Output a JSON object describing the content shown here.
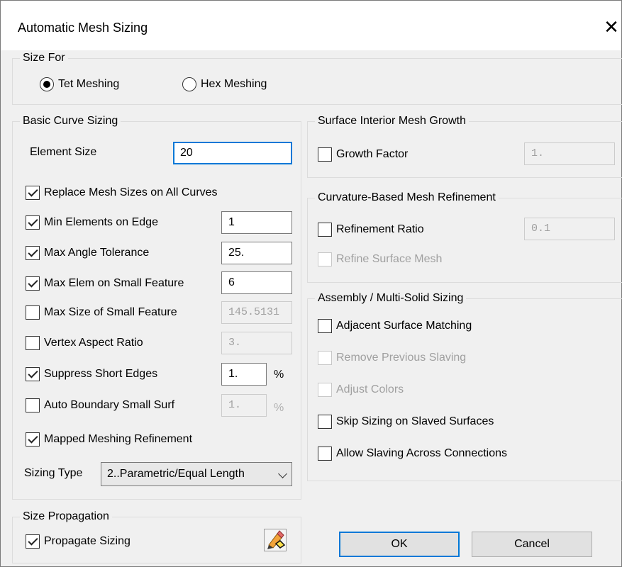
{
  "window": {
    "title": "Automatic Mesh Sizing",
    "close_glyph": "✕"
  },
  "size_for": {
    "label": "Size For",
    "options": [
      {
        "label": "Tet Meshing",
        "selected": true
      },
      {
        "label": "Hex Meshing",
        "selected": false
      }
    ]
  },
  "basic_curve": {
    "label": "Basic Curve Sizing",
    "element_size_label": "Element Size",
    "element_size_value": "20",
    "replace_label": "Replace Mesh Sizes on All Curves",
    "rows": [
      {
        "label": "Min Elements on Edge",
        "checked": true,
        "value": "1",
        "enabled": true
      },
      {
        "label": "Max Angle Tolerance",
        "checked": true,
        "value": "25.",
        "enabled": true
      },
      {
        "label": "Max Elem on Small Feature",
        "checked": true,
        "value": "6",
        "enabled": true
      },
      {
        "label": "Max Size of Small Feature",
        "checked": false,
        "value": "145.5131",
        "enabled": false
      },
      {
        "label": "Vertex Aspect Ratio",
        "checked": false,
        "value": "3.",
        "enabled": false
      },
      {
        "label": "Suppress Short Edges",
        "checked": true,
        "value": "1.",
        "enabled": true,
        "unit": "%"
      },
      {
        "label": "Auto Boundary Small Surf",
        "checked": false,
        "value": "1.",
        "enabled": false,
        "unit": "%"
      }
    ],
    "mapped_label": "Mapped Meshing Refinement",
    "sizing_type_label": "Sizing Type",
    "sizing_type_value": "2..Parametric/Equal Length"
  },
  "size_propagation": {
    "label": "Size Propagation",
    "propagate_label": "Propagate Sizing",
    "icon": "pencil-eraser-icon"
  },
  "surface_growth": {
    "label": "Surface Interior Mesh Growth",
    "growth_label": "Growth  Factor",
    "growth_value": "1."
  },
  "curvature": {
    "label": "Curvature-Based Mesh Refinement",
    "ratio_label": "Refinement Ratio",
    "ratio_value": "0.1",
    "refine_label": "Refine Surface Mesh"
  },
  "assembly": {
    "label": "Assembly / Multi-Solid Sizing",
    "adjacent_label": "Adjacent Surface Matching",
    "remove_label": "Remove Previous Slaving",
    "adjust_label": "Adjust Colors",
    "skip_label": "Skip Sizing on Slaved Surfaces",
    "allow_label": "Allow Slaving Across Connections"
  },
  "buttons": {
    "ok": "OK",
    "cancel": "Cancel"
  },
  "colors": {
    "focus": "#0078d7",
    "dialog_bg": "#f0f0f0"
  }
}
